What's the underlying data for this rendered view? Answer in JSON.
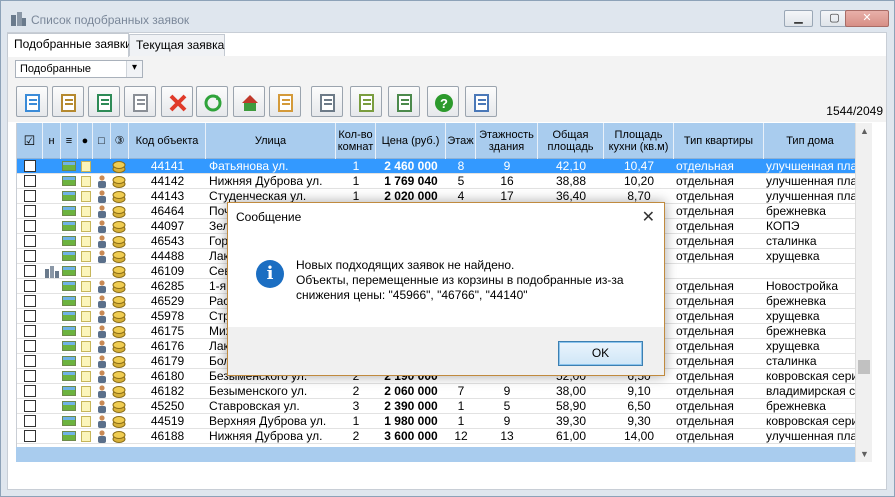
{
  "window": {
    "title": "Список подобранных заявок"
  },
  "tabs": [
    {
      "label": "Подобранные заявки"
    },
    {
      "label": "Текущая заявка"
    }
  ],
  "filter": {
    "selected": "Подобранные"
  },
  "toolbar": {
    "buttons": [
      {
        "name": "edit-icon"
      },
      {
        "name": "tools-icon"
      },
      {
        "name": "document-check-icon"
      },
      {
        "name": "copy-icon"
      },
      {
        "name": "delete-icon"
      },
      {
        "name": "refresh-icon"
      },
      {
        "name": "home-icon"
      },
      {
        "name": "handshake-icon"
      },
      {
        "name": "print-icon"
      },
      {
        "name": "table-icon"
      },
      {
        "name": "list-icon"
      },
      {
        "name": "help-icon"
      },
      {
        "name": "exit-icon"
      }
    ],
    "counter": "1544/2049"
  },
  "columns": {
    "check": "☑",
    "h": "н",
    "stack": "≡",
    "dot": "●",
    "folder": "□",
    "circle3": "③",
    "code": "Код объекта",
    "street": "Улица",
    "rooms": "Кол-во комнат",
    "price": "Цена (руб.)",
    "floor": "Этаж",
    "floors": "Этажность здания",
    "area": "Общая площадь",
    "kitchen": "Площадь кухни (кв.м)",
    "flat_type": "Тип квартиры",
    "house_type": "Тип дома"
  },
  "rows": [
    {
      "code": "44141",
      "street": "Фатьянова ул.",
      "rooms": "1",
      "price": "2 460 000",
      "floor": "8",
      "floors": "9",
      "area": "42,10",
      "kitchen": "10,47",
      "flat_type": "отдельная",
      "house_type": "улучшенная плани",
      "selected": true,
      "person": false
    },
    {
      "code": "44142",
      "street": "Нижняя Дуброва ул.",
      "rooms": "1",
      "price": "1 769 040",
      "floor": "5",
      "floors": "16",
      "area": "38,88",
      "kitchen": "10,20",
      "flat_type": "отдельная",
      "house_type": "улучшенная плани",
      "person": true
    },
    {
      "code": "44143",
      "street": "Студенческая ул.",
      "rooms": "1",
      "price": "2 020 000",
      "floor": "4",
      "floors": "17",
      "area": "36,40",
      "kitchen": "8,70",
      "flat_type": "отдельная",
      "house_type": "улучшенная плани",
      "person": true
    },
    {
      "code": "46464",
      "street": "Почаевская ул.",
      "rooms": "",
      "price": "",
      "floor": "",
      "floors": "",
      "area": "",
      "kitchen": "",
      "flat_type": "отдельная",
      "house_type": "брежневка",
      "person": true
    },
    {
      "code": "44097",
      "street": "Зеленая ул.",
      "rooms": "",
      "price": "",
      "floor": "",
      "floors": "",
      "area": "",
      "kitchen": "",
      "flat_type": "отдельная",
      "house_type": "КОПЭ",
      "person": true
    },
    {
      "code": "46543",
      "street": "Горького ул.",
      "rooms": "",
      "price": "",
      "floor": "",
      "floors": "",
      "area": "",
      "kitchen": "",
      "flat_type": "отдельная",
      "house_type": "сталинка",
      "person": true
    },
    {
      "code": "44488",
      "street": "Лакина ул.",
      "rooms": "",
      "price": "",
      "floor": "",
      "floors": "",
      "area": "",
      "kitchen": "",
      "flat_type": "отдельная",
      "house_type": "хрущевка",
      "person": true
    },
    {
      "code": "46109",
      "street": "Севастопольская ул.",
      "rooms": "",
      "price": "",
      "floor": "",
      "floors": "",
      "area": "",
      "kitchen": "",
      "flat_type": "",
      "house_type": "",
      "person": false,
      "building": true
    },
    {
      "code": "46285",
      "street": "1-я Пионерская ул.",
      "rooms": "",
      "price": "",
      "floor": "",
      "floors": "",
      "area": "",
      "kitchen": "",
      "flat_type": "отдельная",
      "house_type": "Новостройка",
      "person": true
    },
    {
      "code": "46529",
      "street": "Растопчина ул.",
      "rooms": "",
      "price": "",
      "floor": "",
      "floors": "",
      "area": "",
      "kitchen": "",
      "flat_type": "отдельная",
      "house_type": "брежневка",
      "person": true
    },
    {
      "code": "45978",
      "street": "Строителей ул.",
      "rooms": "",
      "price": "",
      "floor": "",
      "floors": "",
      "area": "",
      "kitchen": "",
      "flat_type": "отдельная",
      "house_type": "хрущевка",
      "person": true
    },
    {
      "code": "46175",
      "street": "Михалькова ул.",
      "rooms": "",
      "price": "",
      "floor": "",
      "floors": "",
      "area": "",
      "kitchen": "",
      "flat_type": "отдельная",
      "house_type": "брежневка",
      "person": true
    },
    {
      "code": "46176",
      "street": "Лакина ул.",
      "rooms": "",
      "price": "",
      "floor": "",
      "floors": "",
      "area": "",
      "kitchen": "",
      "flat_type": "отдельная",
      "house_type": "хрущевка",
      "person": true
    },
    {
      "code": "46179",
      "street": "Большая Московская ул.",
      "rooms": "",
      "price": "",
      "floor": "",
      "floors": "",
      "area": "",
      "kitchen": "",
      "flat_type": "отдельная",
      "house_type": "сталинка",
      "person": true
    },
    {
      "code": "46180",
      "street": "Безыменского ул.",
      "rooms": "2",
      "price": "2 190 000",
      "floor": "",
      "floors": "",
      "area": "52,00",
      "kitchen": "6,50",
      "flat_type": "отдельная",
      "house_type": "ковровская сери",
      "person": true
    },
    {
      "code": "46182",
      "street": "Безыменского ул.",
      "rooms": "2",
      "price": "2 060 000",
      "floor": "7",
      "floors": "9",
      "area": "38,00",
      "kitchen": "9,10",
      "flat_type": "отдельная",
      "house_type": "владимирская се",
      "person": true
    },
    {
      "code": "45250",
      "street": "Ставровская ул.",
      "rooms": "3",
      "price": "2 390 000",
      "floor": "1",
      "floors": "5",
      "area": "58,90",
      "kitchen": "6,50",
      "flat_type": "отдельная",
      "house_type": "брежневка",
      "person": true
    },
    {
      "code": "44519",
      "street": "Верхняя Дуброва ул.",
      "rooms": "1",
      "price": "1 980 000",
      "floor": "1",
      "floors": "9",
      "area": "39,30",
      "kitchen": "9,30",
      "flat_type": "отдельная",
      "house_type": "ковровская сери",
      "person": true
    },
    {
      "code": "46188",
      "street": "Нижняя Дуброва ул.",
      "rooms": "2",
      "price": "3 600 000",
      "floor": "12",
      "floors": "13",
      "area": "61,00",
      "kitchen": "14,00",
      "flat_type": "отдельная",
      "house_type": "улучшенная плани",
      "person": true
    }
  ],
  "dialog": {
    "title": "Сообщение",
    "line1": "Новых подходящих заявок не найдено.",
    "line2": "Объекты, перемещенные из корзины в подобранные из-за снижения цены: \"45966\", \"46766\", \"44140\"",
    "ok_label": "OK"
  }
}
